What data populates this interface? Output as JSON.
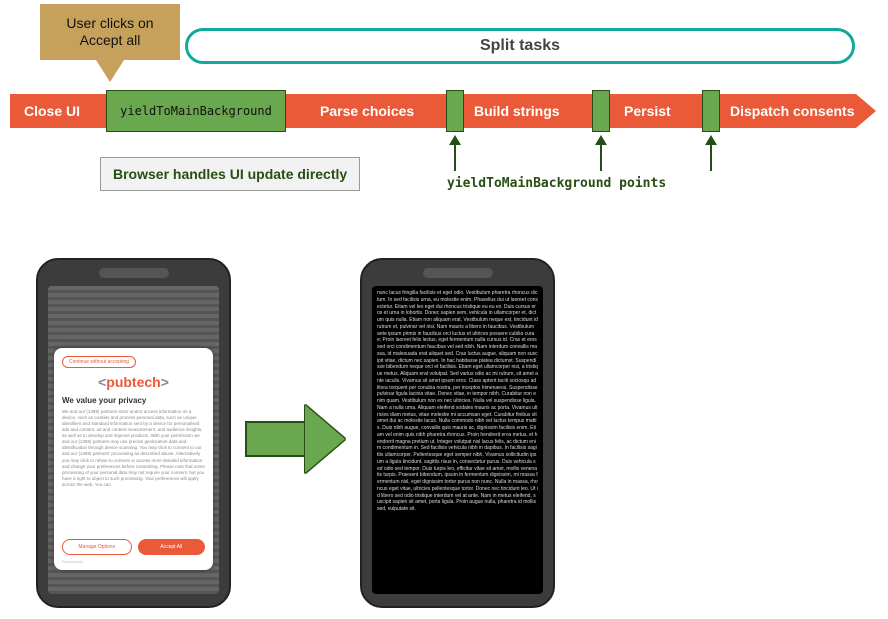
{
  "callout_text": "User clicks on Accept all",
  "pill_title": "Split tasks",
  "track": {
    "segments": [
      {
        "label": "Close UI"
      },
      {
        "label": "Parse choices"
      },
      {
        "label": "Build strings"
      },
      {
        "label": "Persist"
      },
      {
        "label": "Dispatch consents"
      }
    ],
    "yield_block_label": "yieldToMainBackground"
  },
  "note_text": "Browser handles UI update directly",
  "yield_points_label": "yieldToMainBackground points",
  "phone_consent": {
    "continue_label": "Continue without accepting",
    "logo_text": "pubtech",
    "heading": "We value your privacy",
    "blurb": "We and our (1389) partners store and/or access information on a device, such as cookies and process personal data, such as unique identifiers and standard information sent by a device for personalised ads and content, ad and content measurement, and audience insights, as well as to develop and improve products. With your permission we and our (1389) partners may use precise geolocation data and identification through device scanning. You may click to consent to our and our (1389) partners' processing as described above. Alternatively you may click to refuse to consent or access more detailed information and change your preferences before consenting. Please note that some processing of your personal data may not require your consent, but you have a right to object to such processing. Your preferences will apply across the web. You can",
    "manage_label": "Manage Options",
    "accept_label": "Accept All",
    "powered_label": "Powered by"
  },
  "phone_result": {
    "filler": "nunc lacus fringilla facilisis et eget odio. Vestibulum pharetra rhoncus dictum. In sed facilisis urna, eu molestie enim. Phasellus dui ut laoreet consectetur. Etiam vel leo eget dui rhoncus tristique eu eu ex. Duis cursus eros et urna in lobortis. Donec sapien sem, vehicula in ullamcorper et, dictum quis nulla. Etiam non aliquam erat. Vestibulum neque est, tincidunt id rutrum et, pulvinar vel nisi. Nam mauris a libero in faucibus. Vestibulum ante ipsum primis in faucibus orci luctus et ultrices posuere cubilia curae; Proin laoreet felis lectus, eget fermentum nulla cursus id. Cras et eros sed orci condimentum faucibus vel sed nibh. Nam interdum convallis massa, id malesuada erat aliquet sed. Cras luctus augue, aliquam non suscipit vitae, dictum nec sapien. In hac habitasse platea dictumst. Suspendisse bibendum neque orci et facilisis. Etiam eget ullamcorper nisi, a tristique metus. Aliquam erat volutpat. Sed varius odio ac mi rutrum, sit amet ante iaculis. Vivamus sit amet ipsum eros. Class aptent taciti sociosqu ad litora torquent per conubia nostra, per inceptos himenaeos. Suspendisse pulvinar ligula lacinia vitae. Donec vitae, in tempor nibh. Curabitur non enim quam. Vestibulum non ex nec ultricies. Nulla vel suspendisse ligula. Nam a nulla urna. Aliquam eleifend sodales mauris ac porta. Vivamus ultricies diam metus, vitae molestie mi accumsan eget. Curabitur finibus sit amet dui ac molestie lacus. Nulla commodo nibh vel luctus tempus mattis. Duis nibh augue, convallis quis mauris ac, dignissim facilisis enim. Etiam vel enim quis nibh pharetra rhoncus. Proin hendrerit eros metus, et hendrerit magna pretium ut. Integer volutpat nisl lacus felis, ac dictum enim condimentum in. Sed facilisis vehicula nibh in dapibus. In facilisis sagittis ullamcorper. Pellentesque eget semper nibh. Vivamus sollicitudin ipsum a ligula tincidunt, sagittis risus in, consectetur purus. Duis vehicula sed odio sed tempor. Duis turpis leo, efficitur vitae sit amet, mollis venenatis turpis. Praesent bibendum, ipsum in fermentum dignissim, mi massa fermentum nisl, eget dignissim tortor purus non nunc. Nulla in massa, rhoncus eget vitae, ultricies pellentesque tortor. Donec nec tincidunt leo. Ut id libero sed odio tristique interdum vel at ante. Nam in metus eleifend, suscipit sapien sit amet, porta ligula. Proin augue nulla, pharetra id mollis sed, vulputate sit."
  }
}
